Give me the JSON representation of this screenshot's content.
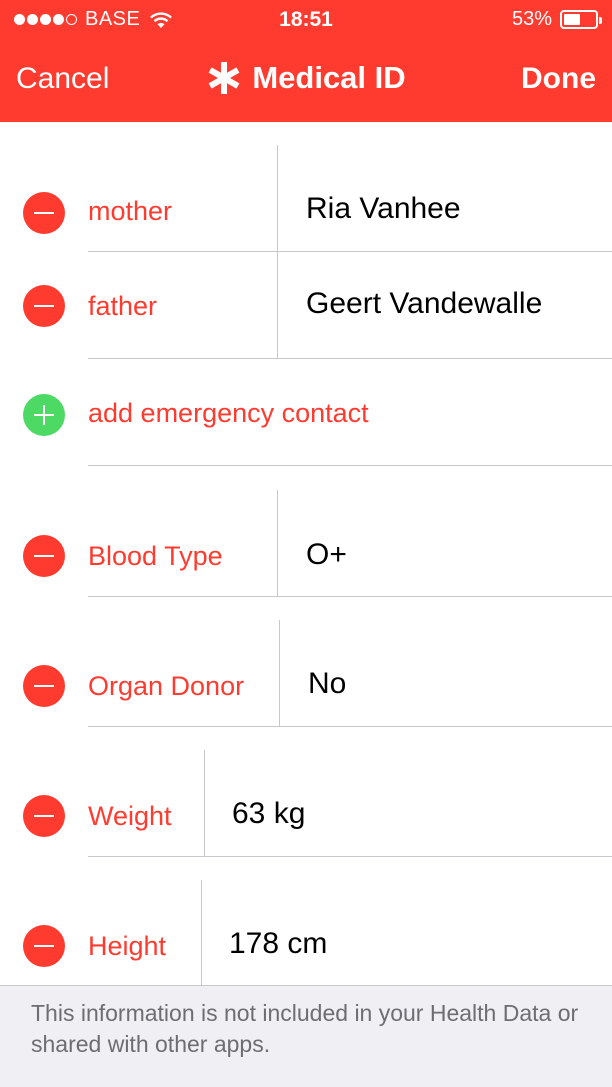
{
  "status_bar": {
    "carrier": "BASE",
    "time": "18:51",
    "battery_percent": "53%",
    "battery_level": 0.53,
    "signal_bars_filled": 4,
    "signal_bars_total": 5
  },
  "nav": {
    "cancel_label": "Cancel",
    "title": "Medical ID",
    "done_label": "Done"
  },
  "emergency_contacts": [
    {
      "relation": "mother",
      "name": "Ria Vanhee"
    },
    {
      "relation": "father",
      "name": "Geert Vandewalle"
    }
  ],
  "add_contact_label": "add emergency contact",
  "fields": {
    "blood_type": {
      "label": "Blood Type",
      "value": "O+"
    },
    "organ_donor": {
      "label": "Organ Donor",
      "value": "No"
    },
    "weight": {
      "label": "Weight",
      "value": "63 kg"
    },
    "height": {
      "label": "Height",
      "value": "178 cm"
    }
  },
  "footer_text": "This information is not included in your Health Data or shared with other apps.",
  "colors": {
    "accent_red": "#ff3b30",
    "add_green": "#4cd964",
    "separator": "#c8c7cc",
    "footer_bg": "#efeff4"
  }
}
